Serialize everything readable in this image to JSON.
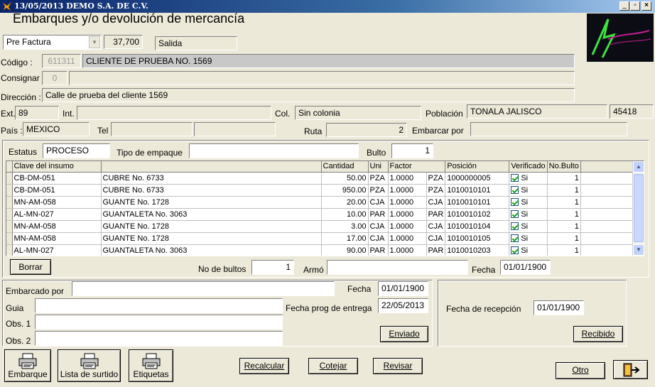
{
  "window": {
    "title": "13/05/2013  DEMO  S.A. DE C.V."
  },
  "form": {
    "heading": "Embarques y/o devolución de mercancía",
    "doc_type": "Pre Factura",
    "doc_number": "37,700",
    "movement": "Salida",
    "codigo_label": "Código :",
    "codigo_id": "611311",
    "codigo_name": "CLIENTE DE PRUEBA NO. 1569",
    "consignar_label": "Consignar",
    "consignar_id": "0",
    "consignar_name": "",
    "direccion_label": "Dirección :",
    "direccion": "Calle de prueba del cliente 1569",
    "ext_label": "Ext.",
    "ext": "89",
    "int_label": "Int.",
    "int": "",
    "col_label": "Col.",
    "col": "Sin colonia",
    "poblacion_label": "Población",
    "poblacion": "TONALA JALISCO",
    "cp": "45418",
    "pais_label": "País :",
    "pais": "MEXICO",
    "tel_label": "Tel",
    "tel1": "",
    "tel2": "",
    "ruta_label": "Ruta",
    "ruta": "2",
    "embarcar_label": "Embarcar por",
    "embarcar": ""
  },
  "detail": {
    "estatus_label": "Estatus",
    "estatus": "PROCESO",
    "empaque_label": "Tipo de empaque",
    "empaque": "",
    "bulto_label": "Bulto",
    "bulto": "1",
    "columns": [
      "Clave del insumo",
      "",
      "Cantidad",
      "Uni",
      "Factor",
      "Posición",
      "Verificado",
      "No.Bulto"
    ],
    "rows": [
      {
        "clave": "CB-DM-051",
        "desc": "CUBRE No. 6733",
        "cantidad": "50.00",
        "uni": "PZA",
        "factor": "1.0000",
        "uni2": "PZA",
        "posicion": "1000000005",
        "verificado": "Si",
        "bulto": "1"
      },
      {
        "clave": "CB-DM-051",
        "desc": "CUBRE No. 6733",
        "cantidad": "950.00",
        "uni": "PZA",
        "factor": "1.0000",
        "uni2": "PZA",
        "posicion": "1010010101",
        "verificado": "Si",
        "bulto": "1"
      },
      {
        "clave": "MN-AM-058",
        "desc": "GUANTE No. 1728",
        "cantidad": "20.00",
        "uni": "CJA",
        "factor": "1.0000",
        "uni2": "CJA",
        "posicion": "1010010101",
        "verificado": "Si",
        "bulto": "1"
      },
      {
        "clave": "AL-MN-027",
        "desc": "GUANTALETA No. 3063",
        "cantidad": "10.00",
        "uni": "PAR",
        "factor": "1.0000",
        "uni2": "PAR",
        "posicion": "1010010102",
        "verificado": "Si",
        "bulto": "1"
      },
      {
        "clave": "MN-AM-058",
        "desc": "GUANTE No. 1728",
        "cantidad": "3.00",
        "uni": "CJA",
        "factor": "1.0000",
        "uni2": "CJA",
        "posicion": "1010010104",
        "verificado": "Si",
        "bulto": "1"
      },
      {
        "clave": "MN-AM-058",
        "desc": "GUANTE No. 1728",
        "cantidad": "17.00",
        "uni": "CJA",
        "factor": "1.0000",
        "uni2": "CJA",
        "posicion": "1010010105",
        "verificado": "Si",
        "bulto": "1"
      },
      {
        "clave": "AL-MN-027",
        "desc": "GUANTALETA No. 3063",
        "cantidad": "90.00",
        "uni": "PAR",
        "factor": "1.0000",
        "uni2": "PAR",
        "posicion": "1010010203",
        "verificado": "Si",
        "bulto": "1"
      }
    ],
    "borrar": "Borrar",
    "no_bultos_label": "No de bultos",
    "no_bultos": "1",
    "armo_label": "Armó",
    "armo": "",
    "fecha_label": "Fecha",
    "fecha": "01/01/1900"
  },
  "shipping": {
    "embarcado_label": "Embarcado por",
    "embarcado": "",
    "fecha_label": "Fecha",
    "fecha": "01/01/1900",
    "guia_label": "Guia",
    "guia": "",
    "fecha_prog_label": "Fecha prog de entrega",
    "fecha_prog": "22/05/2013",
    "obs1_label": "Obs. 1",
    "obs1": "",
    "obs2_label": "Obs. 2",
    "obs2": "",
    "enviado": "Enviado",
    "fecha_recepcion_label": "Fecha de recepción",
    "fecha_recepcion": "01/01/1900",
    "recibido": "Recibido"
  },
  "toolbar": {
    "embarque": "Embarque",
    "lista": "Lista de surtido",
    "etiquetas": "Etiquetas",
    "recalcular": "Recalcular",
    "cotejar": "Cotejar",
    "revisar": "Revisar",
    "otro": "Otro"
  },
  "icons": [
    "app-icon",
    "minimize-icon",
    "maximize-icon",
    "close-icon",
    "dropdown-arrow-icon",
    "printer-icon",
    "exit-door-icon",
    "company-logo"
  ]
}
